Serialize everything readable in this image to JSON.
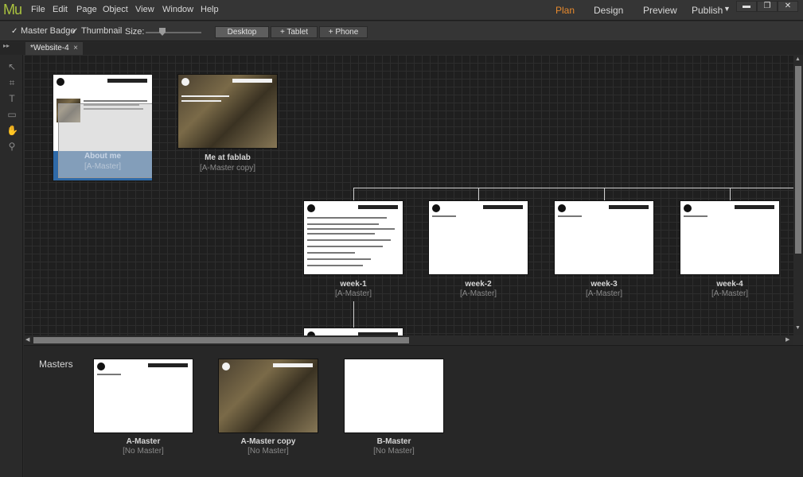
{
  "app": {
    "logo": "Mu"
  },
  "menu": [
    "File",
    "Edit",
    "Page",
    "Object",
    "View",
    "Window",
    "Help"
  ],
  "modes": {
    "plan": "Plan",
    "design": "Design",
    "preview": "Preview",
    "publish": "Publish"
  },
  "window_controls": {
    "minimize": "▬",
    "restore": "❐",
    "close": "✕"
  },
  "toolbar": {
    "master_badge": "Master Badge",
    "thumbnail": "Thumbnail",
    "size_label": "Size:",
    "size_level": 0.3,
    "desktop": "Desktop",
    "tablet": "+ Tablet",
    "phone": "+ Phone"
  },
  "document_tab": {
    "title": "*Website-4",
    "close": "×"
  },
  "pages": {
    "about": {
      "title": "About me",
      "master": "[A-Master]"
    },
    "fablab": {
      "title": "Me at fablab",
      "master": "[A-Master copy]"
    },
    "week1": {
      "title": "week-1",
      "master": "[A-Master]"
    },
    "week2": {
      "title": "week-2",
      "master": "[A-Master]"
    },
    "week3": {
      "title": "week-3",
      "master": "[A-Master]"
    },
    "week4": {
      "title": "week-4",
      "master": "[A-Master]"
    }
  },
  "masters": {
    "label": "Masters",
    "a": {
      "title": "A-Master",
      "master": "[No Master]"
    },
    "a_copy": {
      "title": "A-Master copy",
      "master": "[No Master]"
    },
    "b": {
      "title": "B-Master",
      "master": "[No Master]"
    }
  },
  "icons": [
    "select-tool-icon",
    "crop-tool-icon",
    "text-tool-icon",
    "rectangle-tool-icon",
    "hand-tool-icon",
    "zoom-tool-icon"
  ],
  "colors": {
    "accent": "#e88a2d",
    "logo": "#a9c23f",
    "selection": "#2f6aa8"
  }
}
